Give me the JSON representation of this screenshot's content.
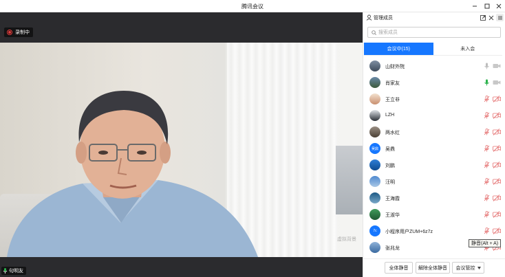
{
  "window": {
    "title": "腾讯会议"
  },
  "video": {
    "recording_label": "录制中",
    "speaker_name": "句明友",
    "watermark": "虚拟背景"
  },
  "panel": {
    "title": "管理成员",
    "search_placeholder": "搜索成员",
    "tabs": [
      {
        "label": "会议中(15)",
        "active": true
      },
      {
        "label": "未入会",
        "active": false
      }
    ],
    "members": [
      {
        "name": "山财外院",
        "avatar": "photo-landscape",
        "mic": "gray",
        "cam": "off"
      },
      {
        "name": "肖家友",
        "avatar": "photo-scene",
        "mic": "green-active",
        "cam": "off"
      },
      {
        "name": "王立非",
        "avatar": "photo-person",
        "mic": "muted",
        "cam": "muted"
      },
      {
        "name": "LZH",
        "avatar": "photo-dark",
        "mic": "muted",
        "cam": "muted"
      },
      {
        "name": "两水红",
        "avatar": "photo-tree",
        "mic": "muted",
        "cam": "muted"
      },
      {
        "name": "吴鼎",
        "avatar": "letter-badge",
        "avatar_text": "吴鼎",
        "mic": "muted",
        "cam": "muted"
      },
      {
        "name": "刘鹏",
        "avatar": "photo-blue",
        "mic": "muted",
        "cam": "muted"
      },
      {
        "name": "汪明",
        "avatar": "photo-sky",
        "mic": "muted",
        "cam": "muted"
      },
      {
        "name": "王海霞",
        "avatar": "photo-sea",
        "mic": "muted",
        "cam": "muted"
      },
      {
        "name": "王淑华",
        "avatar": "photo-green",
        "mic": "muted",
        "cam": "muted"
      },
      {
        "name": "小程序用户ZUM+6z7z",
        "avatar": "letter-badge",
        "avatar_text": "7c",
        "mic": "muted",
        "cam": "muted"
      },
      {
        "name": "张兆龙",
        "avatar": "photo-lake",
        "mic": "muted",
        "cam": "muted"
      }
    ],
    "tooltip": "静音(Alt + A)",
    "bottom": {
      "mute_all": "全体静音",
      "unmute_all": "解除全体静音",
      "control": "会议管控"
    }
  },
  "colors": {
    "accent": "#1677ff",
    "recording": "#e23b3b",
    "mic_active": "#2bb24c",
    "muted": "#e57373"
  }
}
